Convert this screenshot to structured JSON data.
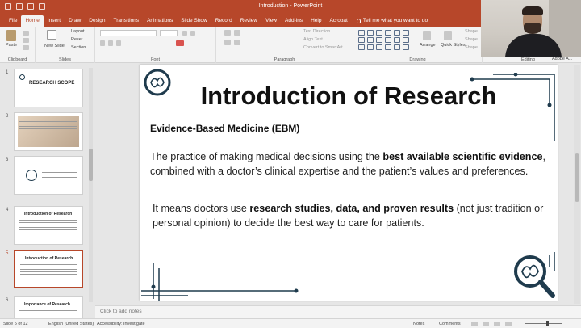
{
  "window": {
    "title": "Introduction  -  PowerPoint"
  },
  "ribbon_tabs": [
    "File",
    "Home",
    "Insert",
    "Draw",
    "Design",
    "Transitions",
    "Animations",
    "Slide Show",
    "Record",
    "Review",
    "View",
    "Add-ins",
    "Help",
    "Acrobat"
  ],
  "tell_me": "Tell me what you want to do",
  "ribbon": {
    "paste": "Paste",
    "new_slide": "New Slide",
    "layout": "Layout",
    "reset": "Reset",
    "section": "Section",
    "text_direction": "Text Direction",
    "align_text": "Align Text",
    "convert_smartart": "Convert to SmartArt",
    "arrange": "Arrange",
    "quick_styles": "Quick Styles",
    "shape_fill": "Shape",
    "shape_outline": "Shape",
    "shape_effects": "Shape",
    "groups": {
      "clipboard": "Clipboard",
      "slides": "Slides",
      "font": "Font",
      "paragraph": "Paragraph",
      "drawing": "Drawing",
      "editing": "Editing",
      "adobe": "Adobe A..."
    }
  },
  "thumbnails": [
    {
      "num": "1",
      "title": "RESEARCH SCOPE"
    },
    {
      "num": "2",
      "title": ""
    },
    {
      "num": "3",
      "title": ""
    },
    {
      "num": "4",
      "title": "Introduction of Research"
    },
    {
      "num": "5",
      "title": "Introduction of Research"
    },
    {
      "num": "6",
      "title": "Importance of Research"
    }
  ],
  "slide": {
    "title": "Introduction of Research",
    "subtitle": "Evidence-Based Medicine (EBM)",
    "p1_a": "The practice of making medical decisions using the ",
    "p1_b": "best available scientific evidence",
    "p1_c": ", combined with a doctor’s clinical expertise and the patient’s values and preferences.",
    "p2_a": "It means doctors use ",
    "p2_b": "research studies, data, and proven results",
    "p2_c": " (not just tradition or personal opinion) to decide the best way to care for patients."
  },
  "notes_placeholder": "Click to add notes",
  "status": {
    "slide_count": "Slide 5 of 12",
    "language": "English (United States)",
    "accessibility": "Accessibility: Investigate",
    "notes": "Notes",
    "comments": "Comments"
  },
  "colors": {
    "accent": "#b7472a",
    "slide_deco": "#1f3b4d"
  }
}
